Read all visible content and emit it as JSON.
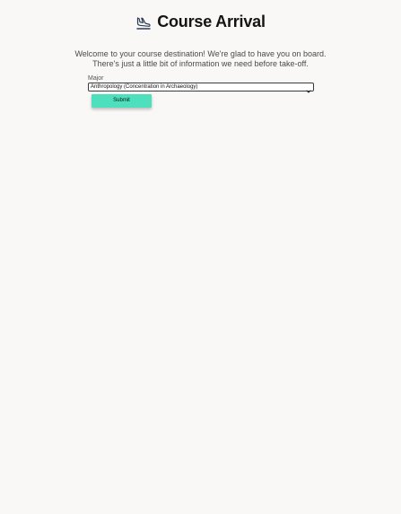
{
  "header": {
    "logo_icon": "plane-landing-icon",
    "title": "Course Arrival"
  },
  "welcome": {
    "line1": "Welcome to your course destination! We're glad to have you on board.",
    "line2": "There's just a little bit of information we need before take-off."
  },
  "form": {
    "major_label": "Major",
    "major_selected": "Anthropology (Concentration in Archaeology)",
    "submit_label": "Submit"
  },
  "colors": {
    "background": "#f9f8f6",
    "accent": "#4ee0bd",
    "logo": "#2b3a55"
  }
}
